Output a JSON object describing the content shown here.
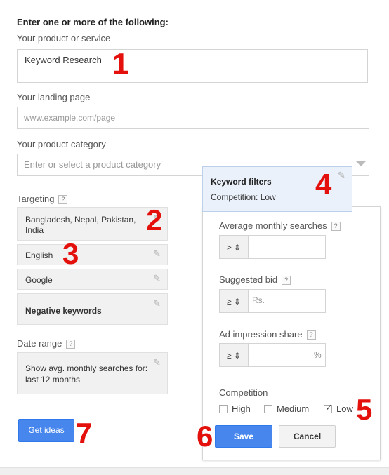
{
  "form": {
    "heading": "Enter one or more of the following:",
    "product_label": "Your product or service",
    "product_value": "Keyword Research",
    "landing_label": "Your landing page",
    "landing_placeholder": "www.example.com/page",
    "category_label": "Your product category",
    "category_placeholder": "Enter or select a product category"
  },
  "targeting": {
    "label": "Targeting",
    "help": "?",
    "locations": "Bangladesh, Nepal, Pakistan, India",
    "language": "English",
    "network": "Google",
    "negative": "Negative keywords"
  },
  "date_range": {
    "label": "Date range",
    "help": "?",
    "text": "Show avg. monthly searches for: last 12 months"
  },
  "actions": {
    "get_ideas": "Get ideas"
  },
  "keyword_filters": {
    "title": "Keyword filters",
    "summary": "Competition: Low",
    "avg_label": "Average monthly searches",
    "bid_label": "Suggested bid",
    "bid_placeholder": "Rs.",
    "share_label": "Ad impression share",
    "share_unit": "%",
    "operator": "≥ ⇕",
    "help": "?",
    "competition_label": "Competition",
    "options": [
      {
        "label": "High",
        "checked": false
      },
      {
        "label": "Medium",
        "checked": false
      },
      {
        "label": "Low",
        "checked": true
      }
    ],
    "save": "Save",
    "cancel": "Cancel"
  },
  "annotations": [
    "1",
    "2",
    "3",
    "4",
    "5",
    "6",
    "7"
  ],
  "colors": {
    "accent": "#4787ed",
    "annotation": "#e4100b",
    "filter_bg": "#eaf1fb"
  }
}
